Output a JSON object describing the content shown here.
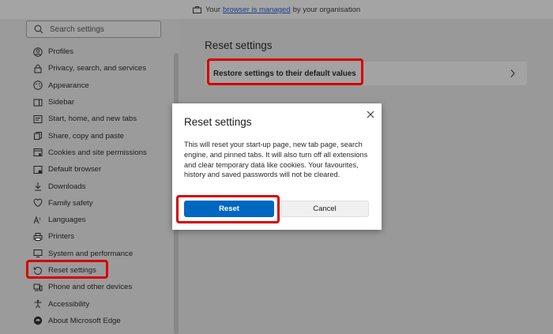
{
  "banner": {
    "prefix": "Your",
    "link": "browser is managed",
    "suffix": "by your organisation",
    "icon": "briefcase-icon"
  },
  "search": {
    "placeholder": "Search settings",
    "icon": "search-icon"
  },
  "sidebar": {
    "items": [
      {
        "label": "Profiles",
        "icon": "profile-icon"
      },
      {
        "label": "Privacy, search, and services",
        "icon": "lock-icon"
      },
      {
        "label": "Appearance",
        "icon": "appearance-icon"
      },
      {
        "label": "Sidebar",
        "icon": "sidebar-icon"
      },
      {
        "label": "Start, home, and new tabs",
        "icon": "home-icon"
      },
      {
        "label": "Share, copy and paste",
        "icon": "share-icon"
      },
      {
        "label": "Cookies and site permissions",
        "icon": "cookie-icon"
      },
      {
        "label": "Default browser",
        "icon": "browser-icon"
      },
      {
        "label": "Downloads",
        "icon": "download-icon"
      },
      {
        "label": "Family safety",
        "icon": "family-icon"
      },
      {
        "label": "Languages",
        "icon": "language-icon"
      },
      {
        "label": "Printers",
        "icon": "printer-icon"
      },
      {
        "label": "System and performance",
        "icon": "system-icon"
      },
      {
        "label": "Reset settings",
        "icon": "reset-icon",
        "active": true
      },
      {
        "label": "Phone and other devices",
        "icon": "phone-icon"
      },
      {
        "label": "Accessibility",
        "icon": "accessibility-icon"
      },
      {
        "label": "About Microsoft Edge",
        "icon": "edge-icon"
      }
    ]
  },
  "main": {
    "title": "Reset settings",
    "restore_label": "Restore settings to their default values"
  },
  "dialog": {
    "title": "Reset settings",
    "body": "This will reset your start-up page, new tab page, search engine, and pinned tabs. It will also turn off all extensions and clear temporary data like cookies. Your favourites, history and saved passwords will not be cleared.",
    "reset_label": "Reset",
    "cancel_label": "Cancel"
  },
  "colors": {
    "highlight": "#d60000",
    "primary_button": "#0067c0",
    "overlay": "#9a9a9a"
  }
}
